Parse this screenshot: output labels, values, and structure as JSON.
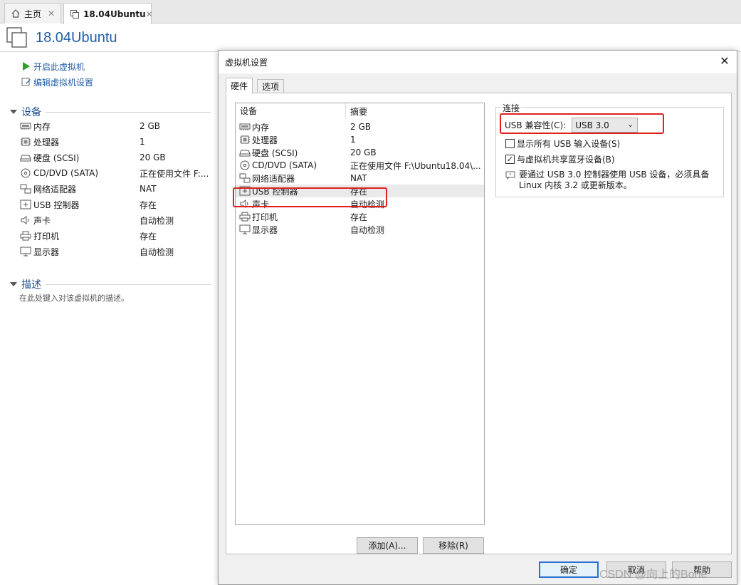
{
  "tabs": [
    {
      "label": "主页",
      "icon": "home-icon"
    },
    {
      "label": "18.04Ubuntu",
      "icon": "vm-icon"
    }
  ],
  "vm": {
    "title": "18.04Ubuntu"
  },
  "actions": {
    "power_on": "开启此虚拟机",
    "edit_settings": "编辑虚拟机设置"
  },
  "left_panel": {
    "devices_header": "设备",
    "devices": [
      {
        "name": "内存",
        "value": "2 GB",
        "icon": "memory-icon"
      },
      {
        "name": "处理器",
        "value": "1",
        "icon": "cpu-icon"
      },
      {
        "name": "硬盘 (SCSI)",
        "value": "20 GB",
        "icon": "harddisk-icon"
      },
      {
        "name": "CD/DVD (SATA)",
        "value": "正在使用文件 F:...",
        "icon": "cdrom-icon"
      },
      {
        "name": "网络适配器",
        "value": "NAT",
        "icon": "network-icon"
      },
      {
        "name": "USB 控制器",
        "value": "存在",
        "icon": "usb-icon"
      },
      {
        "name": "声卡",
        "value": "自动检测",
        "icon": "sound-icon"
      },
      {
        "name": "打印机",
        "value": "存在",
        "icon": "printer-icon"
      },
      {
        "name": "显示器",
        "value": "自动检测",
        "icon": "display-icon"
      }
    ],
    "description_header": "描述",
    "description_placeholder": "在此处键入对该虚拟机的描述。"
  },
  "dialog": {
    "title": "虚拟机设置",
    "close": "✕",
    "tabs": [
      "硬件",
      "选项"
    ],
    "list_headers": {
      "device": "设备",
      "summary": "摘要"
    },
    "devices": [
      {
        "name": "内存",
        "value": "2 GB",
        "icon": "memory-icon"
      },
      {
        "name": "处理器",
        "value": "1",
        "icon": "cpu-icon"
      },
      {
        "name": "硬盘 (SCSI)",
        "value": "20 GB",
        "icon": "harddisk-icon"
      },
      {
        "name": "CD/DVD (SATA)",
        "value": "正在使用文件 F:\\Ubuntu18.04\\...",
        "icon": "cdrom-icon"
      },
      {
        "name": "网络适配器",
        "value": "NAT",
        "icon": "network-icon"
      },
      {
        "name": "USB 控制器",
        "value": "存在",
        "icon": "usb-icon",
        "selected": true
      },
      {
        "name": "声卡",
        "value": "自动检测",
        "icon": "sound-icon"
      },
      {
        "name": "打印机",
        "value": "存在",
        "icon": "printer-icon"
      },
      {
        "name": "显示器",
        "value": "自动检测",
        "icon": "display-icon"
      }
    ],
    "add_button": "添加(A)...",
    "remove_button": "移除(R)",
    "connection": {
      "group_label": "连接",
      "usb_compat_label": "USB 兼容性(C):",
      "usb_compat_value": "USB 3.0",
      "show_all_usb_label": "显示所有 USB 输入设备(S)",
      "show_all_usb_checked": false,
      "share_bluetooth_label": "与虚拟机共享蓝牙设备(B)",
      "share_bluetooth_checked": true,
      "info_line1": "要通过 USB 3.0 控制器使用 USB 设备，必须具备",
      "info_line2": "Linux 内核 3.2 或更新版本。"
    },
    "ok_button": "确定",
    "cancel_button": "取消",
    "help_button": "帮助"
  },
  "watermark": "CSDN @向上的Bone",
  "colors": {
    "accent": "#1f5fa8",
    "highlight": "#e02020",
    "play": "#2aa12a"
  }
}
